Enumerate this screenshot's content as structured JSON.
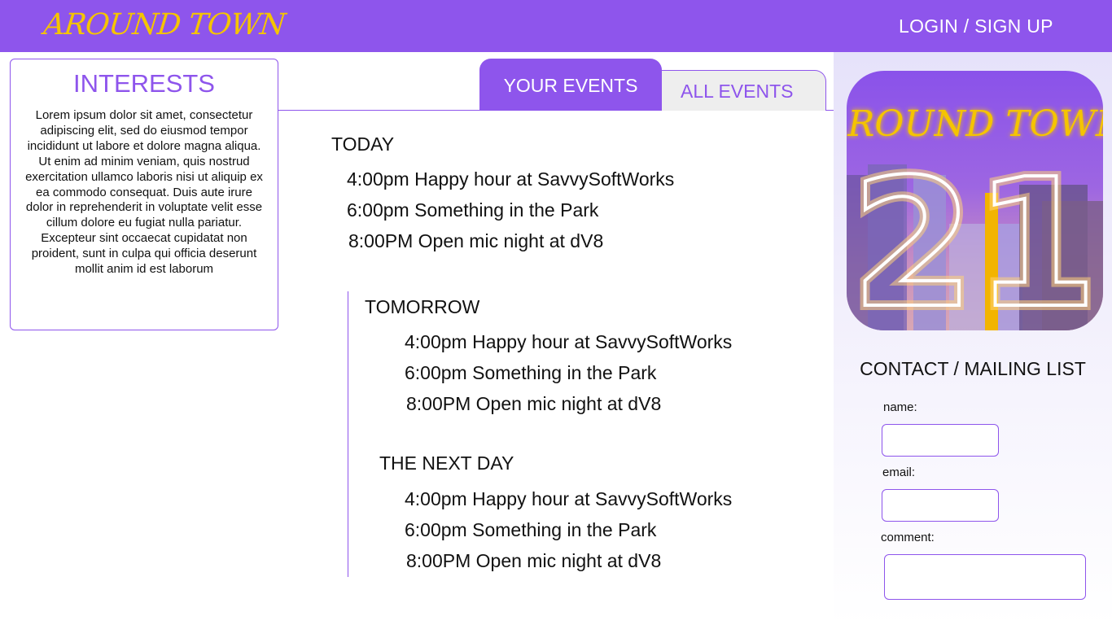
{
  "header": {
    "brand": "AROUND TOWN",
    "login_label": "LOGIN / SIGN UP",
    "bg_color": "#8e55ec",
    "brand_color": "#f5c400"
  },
  "interests": {
    "title": "INTERESTS",
    "body": "Lorem ipsum dolor sit amet, consectetur adipiscing elit, sed do eiusmod tempor incididunt ut labore et dolore magna aliqua. Ut enim ad minim veniam, quis nostrud exercitation ullamco laboris nisi ut aliquip ex ea commodo consequat. Duis aute irure dolor in reprehenderit in voluptate velit esse cillum dolore eu fugiat nulla pariatur. Excepteur sint occaecat cupidatat non proident, sunt in culpa qui officia deserunt mollit anim id est laborum"
  },
  "tabs": {
    "active": "YOUR EVENTS",
    "inactive": "ALL EVENTS"
  },
  "days": [
    {
      "title": "TODAY",
      "events": [
        "4:00pm Happy hour at SavvySoftWorks",
        "6:00pm Something in the Park",
        "8:00PM Open mic night at dV8"
      ]
    },
    {
      "title": "TOMORROW",
      "events": [
        "4:00pm Happy hour at SavvySoftWorks",
        "6:00pm Something in the Park",
        "8:00PM Open mic night at dV8"
      ]
    },
    {
      "title": "THE NEXT DAY",
      "events": [
        "4:00pm Happy hour at SavvySoftWorks",
        "6:00pm Something in the Park",
        "8:00PM Open mic night at dV8"
      ]
    }
  ],
  "logo": {
    "brand": "AROUND TOWN",
    "number": "21"
  },
  "contact": {
    "title": "CONTACT / MAILING LIST",
    "name_label": "name:",
    "email_label": "email:",
    "comment_label": "comment:",
    "name_value": "",
    "email_value": "",
    "comment_value": ""
  }
}
